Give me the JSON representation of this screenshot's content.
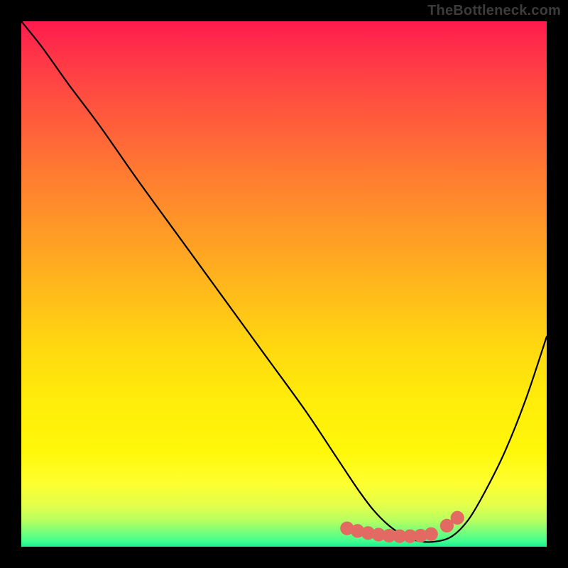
{
  "watermark": {
    "text": "TheBottleneck.com"
  },
  "chart_data": {
    "type": "line",
    "title": "",
    "xlabel": "",
    "ylabel": "",
    "xlim": [
      0,
      100
    ],
    "ylim": [
      0,
      100
    ],
    "series": [
      {
        "name": "bottleneck-curve",
        "x": [
          0,
          4,
          9,
          15,
          22,
          30,
          38,
          46,
          54,
          60,
          64,
          67,
          70,
          73,
          76,
          79,
          82,
          85,
          88,
          92,
          96,
          100
        ],
        "values": [
          100,
          95,
          88,
          80,
          70,
          59,
          48,
          37,
          26,
          17,
          11,
          7,
          4,
          2,
          1,
          1,
          2,
          5,
          10,
          18,
          28,
          40
        ]
      }
    ],
    "markers": {
      "name": "highlight-dots",
      "color": "#e26a63",
      "points": [
        {
          "x": 62,
          "y": 3.5
        },
        {
          "x": 64,
          "y": 3.0
        },
        {
          "x": 66,
          "y": 2.6
        },
        {
          "x": 68,
          "y": 2.3
        },
        {
          "x": 70,
          "y": 2.1
        },
        {
          "x": 72,
          "y": 2.0
        },
        {
          "x": 74,
          "y": 2.0
        },
        {
          "x": 76,
          "y": 2.1
        },
        {
          "x": 78,
          "y": 2.4
        },
        {
          "x": 81,
          "y": 4.0
        },
        {
          "x": 83,
          "y": 5.5
        }
      ],
      "radius": 1.3
    }
  }
}
